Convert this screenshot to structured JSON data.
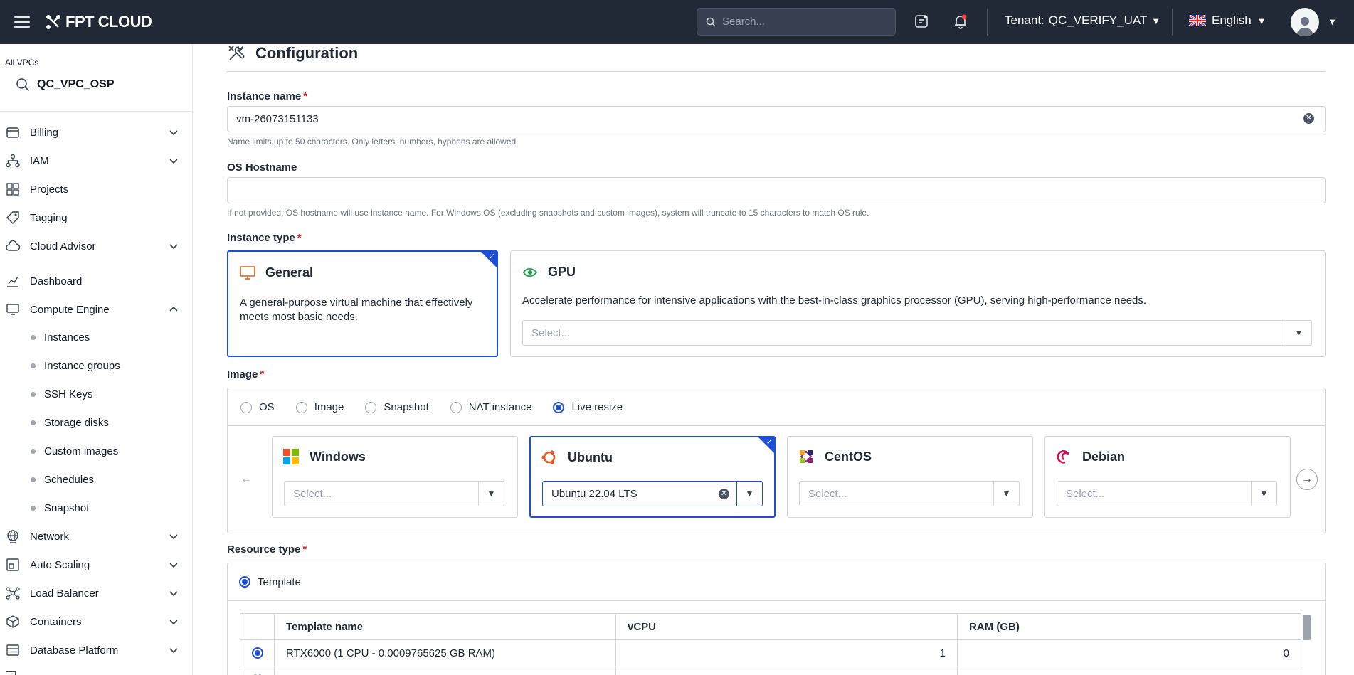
{
  "topbar": {
    "brand": "FPT CLOUD",
    "search_placeholder": "Search...",
    "tenant_label": "Tenant:",
    "tenant_value": "QC_VERIFY_UAT",
    "language": "English"
  },
  "sidebar": {
    "vpc_label": "All VPCs",
    "vpc_value": "QC_VPC_OSP",
    "items": [
      {
        "label": "Billing",
        "icon": "wallet-icon"
      },
      {
        "label": "IAM",
        "icon": "hierarchy-icon"
      },
      {
        "label": "Projects",
        "icon": "grid-icon"
      },
      {
        "label": "Tagging",
        "icon": "tag-icon"
      },
      {
        "label": "Cloud Advisor",
        "icon": "cloud-icon"
      },
      {
        "label": "Dashboard",
        "icon": "chart-icon"
      },
      {
        "label": "Compute Engine",
        "icon": "monitor-icon"
      },
      {
        "label": "Network",
        "icon": "globe-icon"
      },
      {
        "label": "Auto Scaling",
        "icon": "scaling-icon"
      },
      {
        "label": "Load Balancer",
        "icon": "network-icon"
      },
      {
        "label": "Containers",
        "icon": "box-icon"
      },
      {
        "label": "Database Platform",
        "icon": "database-icon"
      }
    ],
    "compute_sub": [
      "Instances",
      "Instance groups",
      "SSH Keys",
      "Storage disks",
      "Custom images",
      "Schedules",
      "Snapshot"
    ]
  },
  "config": {
    "title": "Configuration",
    "instance_name_label": "Instance name",
    "instance_name_value": "vm-26073151133",
    "instance_name_hint": "Name limits up to 50 characters. Only letters, numbers, hyphens are allowed",
    "hostname_label": "OS Hostname",
    "hostname_value": "",
    "hostname_hint": "If not provided, OS hostname will use instance name. For Windows OS (excluding snapshots and custom images), system will truncate to 15 characters to match OS rule.",
    "instance_type_label": "Instance type",
    "general_title": "General",
    "general_desc": "A general-purpose virtual machine that effectively meets most basic needs.",
    "gpu_title": "GPU",
    "gpu_desc": "Accelerate performance for intensive applications with the best-in-class graphics processor (GPU), serving high-performance needs.",
    "gpu_select_placeholder": "Select...",
    "image_label": "Image",
    "image_tabs": [
      "OS",
      "Image",
      "Snapshot",
      "NAT instance",
      "Live resize"
    ],
    "image_tab_selected": "Live resize",
    "os_cards": [
      {
        "name": "Windows",
        "value": "Select..."
      },
      {
        "name": "Ubuntu",
        "value": "Ubuntu 22.04 LTS"
      },
      {
        "name": "CentOS",
        "value": "Select..."
      },
      {
        "name": "Debian",
        "value": "Select..."
      }
    ],
    "resource_type_label": "Resource type",
    "resource_option": "Template",
    "table_headers": [
      "Template name",
      "vCPU",
      "RAM (GB)"
    ],
    "table_rows": [
      {
        "name": "RTX6000 (1 CPU - 0.0009765625 GB RAM)",
        "vcpu": "1",
        "ram": "0"
      }
    ]
  },
  "colors": {
    "topbar_bg": "#212936",
    "accent": "#1d4ed8",
    "required": "#dc2626"
  }
}
